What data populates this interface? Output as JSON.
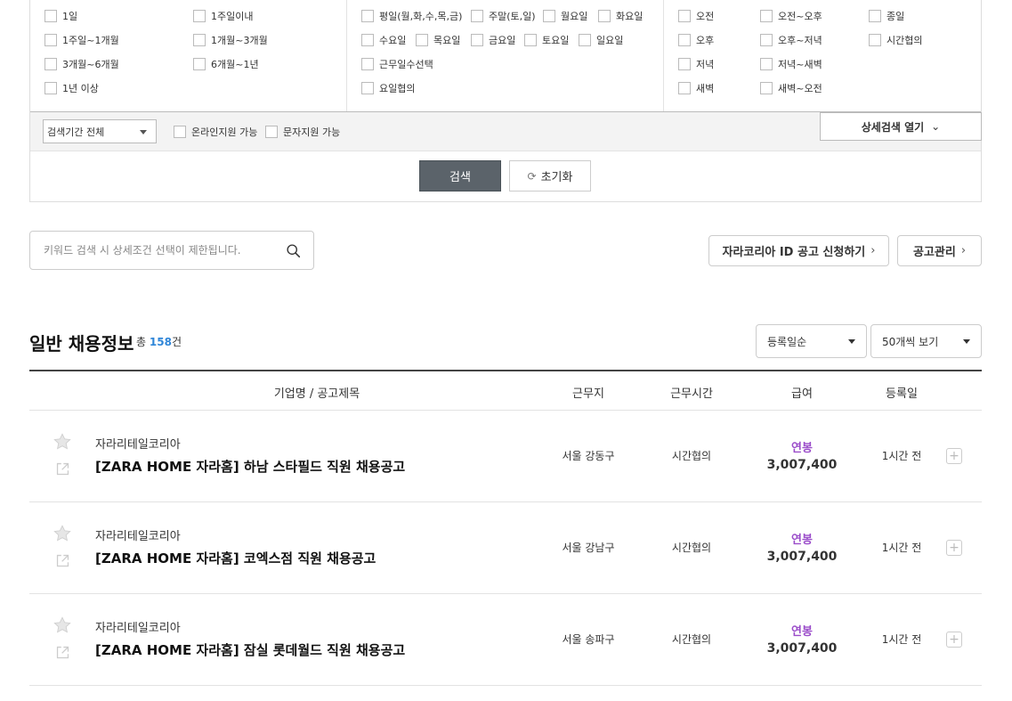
{
  "filters": {
    "period": [
      "1일",
      "1주일이내",
      "1주일~1개월",
      "1개월~3개월",
      "3개월~6개월",
      "6개월~1년",
      "1년 이상"
    ],
    "days": [
      "평일(월,화,수,목,금)",
      "주말(토,일)",
      "월요일",
      "화요일",
      "수요일",
      "목요일",
      "금요일",
      "토요일",
      "일요일",
      "근무일수선택",
      "요일협의"
    ],
    "times": [
      "오전",
      "오전~오후",
      "종일",
      "오후",
      "오후~저녁",
      "시간협의",
      "저녁",
      "저녁~새벽",
      "새벽",
      "새벽~오전"
    ],
    "search_period_select": "검색기간 전체",
    "online_apply": "온라인지원 가능",
    "sms_apply": "문자지원 가능",
    "detail_open": "상세검색 열기",
    "search_label": "검색",
    "reset_label": "초기화"
  },
  "keyword": {
    "placeholder": "키워드 검색 시 상세조건 선택이 제한됩니다."
  },
  "actions": {
    "apply_label": "자라코리아 ID 공고 신청하기",
    "manage_label": "공고관리"
  },
  "list": {
    "title": "일반 채용정보",
    "count_prefix": "총",
    "count": "158",
    "count_suffix": "건",
    "sort": "등록일순",
    "page_size": "50개씩 보기",
    "columns": [
      "기업명 / 공고제목",
      "근무지",
      "근무시간",
      "급여",
      "등록일"
    ],
    "rows": [
      {
        "company": "자라리테일코리아",
        "title": "[ZARA HOME 자라홈] 하남 스타필드 직원 채용공고",
        "location": "서울 강동구",
        "hours": "시간협의",
        "salary_type": "연봉",
        "salary": "3,007,400",
        "posted": "1시간 전"
      },
      {
        "company": "자라리테일코리아",
        "title": "[ZARA HOME 자라홈] 코엑스점 직원 채용공고",
        "location": "서울 강남구",
        "hours": "시간협의",
        "salary_type": "연봉",
        "salary": "3,007,400",
        "posted": "1시간 전"
      },
      {
        "company": "자라리테일코리아",
        "title": "[ZARA HOME 자라홈] 잠실 롯데월드 직원 채용공고",
        "location": "서울 송파구",
        "hours": "시간협의",
        "salary_type": "연봉",
        "salary": "3,007,400",
        "posted": "1시간 전"
      }
    ]
  },
  "colors": {
    "accent_blue": "#2f86d8",
    "salary_purple": "#9b4dca",
    "search_button": "#5b636a"
  }
}
